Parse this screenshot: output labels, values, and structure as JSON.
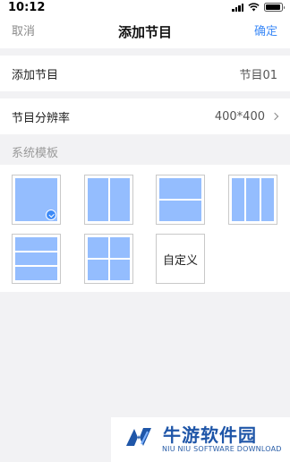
{
  "status_bar": {
    "time": "10:12",
    "battery_level": 0.95
  },
  "nav": {
    "cancel_label": "取消",
    "title": "添加节目",
    "confirm_label": "确定"
  },
  "program_name": {
    "label": "添加节目",
    "value": "节目01"
  },
  "resolution": {
    "label": "节目分辨率",
    "value": "400*400"
  },
  "templates": {
    "section_label": "系统模板",
    "items": [
      {
        "id": "single",
        "selected": true
      },
      {
        "id": "two-columns",
        "selected": false
      },
      {
        "id": "two-rows",
        "selected": false
      },
      {
        "id": "three-columns",
        "selected": false
      },
      {
        "id": "three-rows",
        "selected": false
      },
      {
        "id": "four-grid",
        "selected": false
      },
      {
        "id": "custom",
        "label": "自定义",
        "selected": false
      }
    ]
  },
  "colors": {
    "accent": "#3d8af7",
    "template_fill": "#94bdfe"
  },
  "watermark": {
    "title": "牛游软件园",
    "subtitle": "NIU NIU SOFTWARE DOWNLOAD"
  }
}
